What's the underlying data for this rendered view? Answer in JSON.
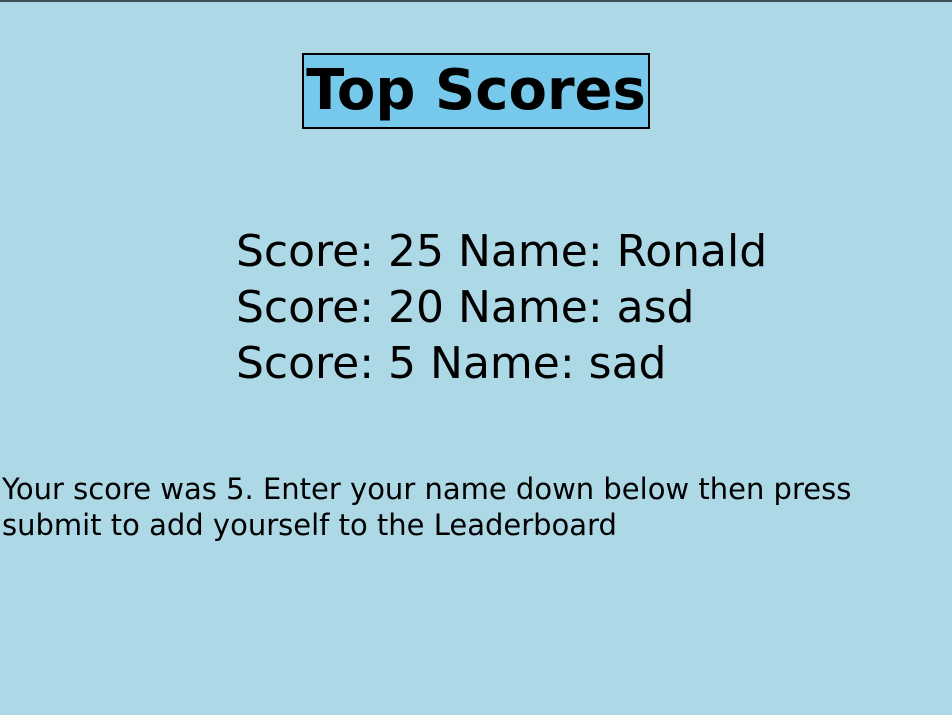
{
  "leaderboard": {
    "title": "Top Scores",
    "entries": [
      {
        "text": "Score: 25 Name: Ronald"
      },
      {
        "text": "Score: 20 Name: asd"
      },
      {
        "text": "Score: 5 Name: sad"
      }
    ]
  },
  "prompt": {
    "message": "Your score was 5. Enter your name down below then press submit to add yourself to the Leaderboard"
  },
  "colors": {
    "background": "#add8e6",
    "title_background": "#76c9eb"
  }
}
